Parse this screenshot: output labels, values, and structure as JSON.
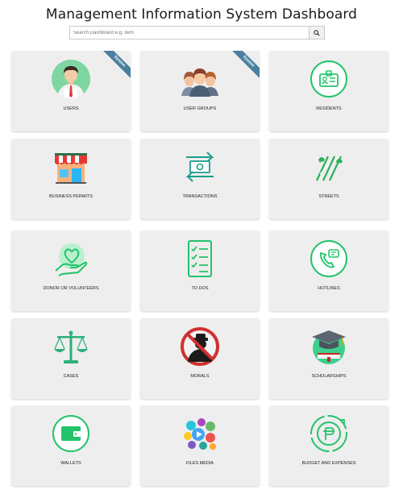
{
  "header": {
    "title": "Management Information System Dashboard"
  },
  "search": {
    "placeholder": "Search Dashboard e.g. item",
    "button_icon": "search-icon"
  },
  "colors": {
    "accent": "#2ecc71",
    "card_bg": "#eeeeee",
    "ribbon": "#4a7fa0"
  },
  "cards": [
    {
      "label": "USERS",
      "icon": "user-avatar-icon",
      "badge": "System"
    },
    {
      "label": "USER GROUPS",
      "icon": "user-group-icon",
      "badge": "System"
    },
    {
      "label": "RESIDENTS",
      "icon": "id-card-icon"
    },
    {
      "label": "BUSINESS PERMITS",
      "icon": "storefront-icon"
    },
    {
      "label": "TRANSACTIONS",
      "icon": "money-exchange-icon"
    },
    {
      "label": "STREETS",
      "icon": "street-icon"
    },
    {
      "label": "DONOR OR VOLUNTEERS",
      "icon": "heart-hand-icon"
    },
    {
      "label": "TO DOS",
      "icon": "checklist-icon"
    },
    {
      "label": "HOTLINES",
      "icon": "phone-chat-icon"
    },
    {
      "label": "CASES",
      "icon": "scales-icon"
    },
    {
      "label": "MORALS",
      "icon": "no-crime-icon"
    },
    {
      "label": "SCHOLARSHIPS",
      "icon": "graduation-cap-icon"
    },
    {
      "label": "WALLETS",
      "icon": "wallet-icon"
    },
    {
      "label": "FILES MEDIA",
      "icon": "media-files-icon"
    },
    {
      "label": "BUDGET AND EXPENSES",
      "icon": "coin-chart-icon"
    }
  ]
}
